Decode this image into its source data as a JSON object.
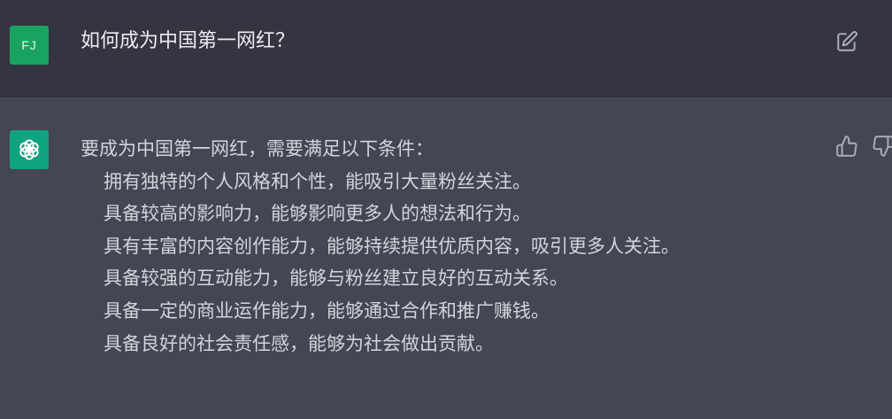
{
  "user_message": {
    "avatar_initials": "FJ",
    "text": "如何成为中国第一网红？"
  },
  "assistant_message": {
    "intro": "要成为中国第一网红，需要满足以下条件：",
    "items": [
      "拥有独特的个人风格和个性，能吸引大量粉丝关注。",
      "具备较高的影响力，能够影响更多人的想法和行为。",
      "具有丰富的内容创作能力，能够持续提供优质内容，吸引更多人关注。",
      "具备较强的互动能力，能够与粉丝建立良好的互动关系。",
      "具备一定的商业运作能力，能够通过合作和推广赚钱。",
      "具备良好的社会责任感，能够为社会做出贡献。"
    ]
  },
  "icons": {
    "edit": "edit-icon",
    "bot_avatar": "openai-logo-icon",
    "thumb_up": "thumbs-up-icon",
    "thumb_down": "thumbs-down-icon"
  },
  "colors": {
    "user_row_bg": "#343541",
    "assistant_row_bg": "#444654",
    "user_avatar_bg": "#1aa260",
    "bot_avatar_bg": "#10a37f",
    "text_primary": "#ececf1",
    "text_answer": "#d1d5db",
    "icon_color": "#acacbe"
  }
}
